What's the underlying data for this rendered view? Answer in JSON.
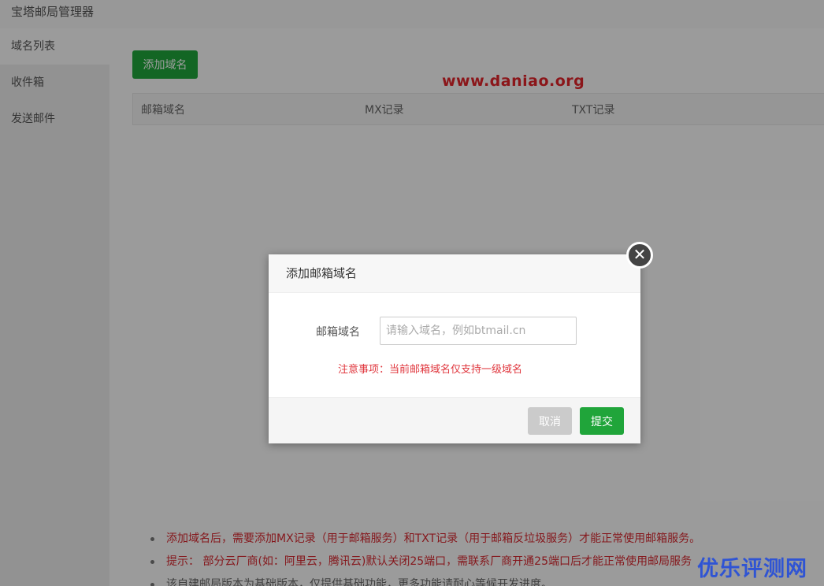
{
  "app": {
    "title": "宝塔邮局管理器"
  },
  "sidebar": {
    "items": [
      {
        "label": "域名列表",
        "active": true
      },
      {
        "label": "收件箱",
        "active": false
      },
      {
        "label": "发送邮件",
        "active": false
      }
    ]
  },
  "main": {
    "add_button": "添加域名",
    "table": {
      "columns": [
        "邮箱域名",
        "MX记录",
        "TXT记录"
      ],
      "rows": []
    },
    "tips": [
      "添加域名后，需要添加MX记录（用于邮箱服务）和TXT记录（用于邮箱反垃圾服务）才能正常使用邮箱服务。",
      "提示： 部分云厂商(如：阿里云，腾讯云)默认关闭25端口，需联系厂商开通25端口后才能正常使用邮局服务",
      "该自建邮局版本为基础版本，仅提供基础功能，更多功能请耐心等候开发进度。"
    ]
  },
  "watermark": "www.daniao.org",
  "corner_mark": "优乐评测网",
  "dialog": {
    "title": "添加邮箱域名",
    "field_label": "邮箱域名",
    "input_value": "",
    "input_placeholder": "请输入域名，例如btmail.cn",
    "note": "注意事项：当前邮箱域名仅支持一级域名",
    "cancel_label": "取消",
    "submit_label": "提交",
    "close_icon": "close-icon"
  },
  "colors": {
    "primary": "#20a53a",
    "warning": "#e0383f",
    "watermark": "#e1242b",
    "corner_mark": "#2f54d4"
  }
}
